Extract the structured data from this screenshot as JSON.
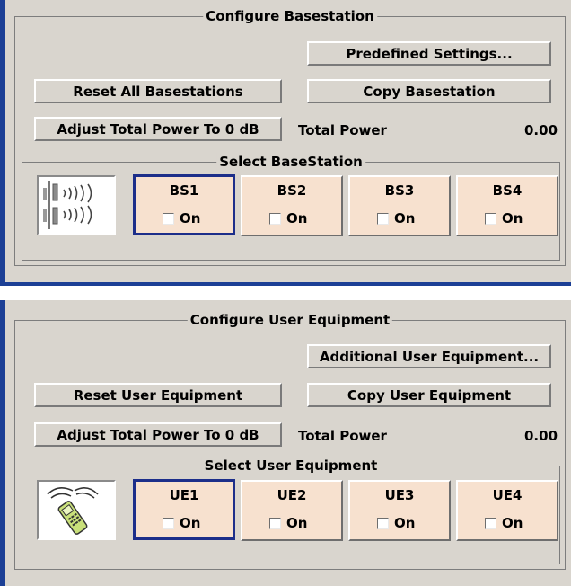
{
  "basestation_panel": {
    "group_title": "Configure Basestation",
    "predefined_settings_label": "Predefined Settings...",
    "reset_all_label": "Reset All Basestations",
    "copy_label": "Copy Basestation",
    "adjust_power_label": "Adjust Total Power To 0 dB",
    "total_power_label": "Total Power",
    "total_power_value": "0.00",
    "select_group_title": "Select BaseStation",
    "icon": "antenna-mast-icon",
    "stations": [
      {
        "label": "BS1",
        "on_label": "On",
        "checked": false,
        "selected": true
      },
      {
        "label": "BS2",
        "on_label": "On",
        "checked": false,
        "selected": false
      },
      {
        "label": "BS3",
        "on_label": "On",
        "checked": false,
        "selected": false
      },
      {
        "label": "BS4",
        "on_label": "On",
        "checked": false,
        "selected": false
      }
    ]
  },
  "ue_panel": {
    "group_title": "Configure User Equipment",
    "additional_ue_label": "Additional User Equipment...",
    "reset_label": "Reset User Equipment",
    "copy_label": "Copy User Equipment",
    "adjust_power_label": "Adjust Total Power To 0 dB",
    "total_power_label": "Total Power",
    "total_power_value": "0.00",
    "select_group_title": "Select User Equipment",
    "icon": "mobile-phone-icon",
    "equipment": [
      {
        "label": "UE1",
        "on_label": "On",
        "checked": false,
        "selected": true
      },
      {
        "label": "UE2",
        "on_label": "On",
        "checked": false,
        "selected": false
      },
      {
        "label": "UE3",
        "on_label": "On",
        "checked": false,
        "selected": false
      },
      {
        "label": "UE4",
        "on_label": "On",
        "checked": false,
        "selected": false
      }
    ]
  }
}
